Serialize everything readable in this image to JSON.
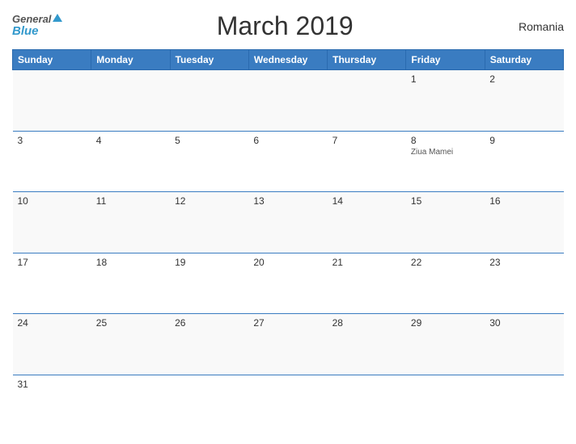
{
  "header": {
    "title": "March 2019",
    "country": "Romania",
    "logo_general": "General",
    "logo_blue": "Blue"
  },
  "days_of_week": [
    "Sunday",
    "Monday",
    "Tuesday",
    "Wednesday",
    "Thursday",
    "Friday",
    "Saturday"
  ],
  "weeks": [
    [
      {
        "num": "",
        "holiday": ""
      },
      {
        "num": "",
        "holiday": ""
      },
      {
        "num": "",
        "holiday": ""
      },
      {
        "num": "",
        "holiday": ""
      },
      {
        "num": "",
        "holiday": ""
      },
      {
        "num": "1",
        "holiday": ""
      },
      {
        "num": "2",
        "holiday": ""
      }
    ],
    [
      {
        "num": "3",
        "holiday": ""
      },
      {
        "num": "4",
        "holiday": ""
      },
      {
        "num": "5",
        "holiday": ""
      },
      {
        "num": "6",
        "holiday": ""
      },
      {
        "num": "7",
        "holiday": ""
      },
      {
        "num": "8",
        "holiday": "Ziua Mamei"
      },
      {
        "num": "9",
        "holiday": ""
      }
    ],
    [
      {
        "num": "10",
        "holiday": ""
      },
      {
        "num": "11",
        "holiday": ""
      },
      {
        "num": "12",
        "holiday": ""
      },
      {
        "num": "13",
        "holiday": ""
      },
      {
        "num": "14",
        "holiday": ""
      },
      {
        "num": "15",
        "holiday": ""
      },
      {
        "num": "16",
        "holiday": ""
      }
    ],
    [
      {
        "num": "17",
        "holiday": ""
      },
      {
        "num": "18",
        "holiday": ""
      },
      {
        "num": "19",
        "holiday": ""
      },
      {
        "num": "20",
        "holiday": ""
      },
      {
        "num": "21",
        "holiday": ""
      },
      {
        "num": "22",
        "holiday": ""
      },
      {
        "num": "23",
        "holiday": ""
      }
    ],
    [
      {
        "num": "24",
        "holiday": ""
      },
      {
        "num": "25",
        "holiday": ""
      },
      {
        "num": "26",
        "holiday": ""
      },
      {
        "num": "27",
        "holiday": ""
      },
      {
        "num": "28",
        "holiday": ""
      },
      {
        "num": "29",
        "holiday": ""
      },
      {
        "num": "30",
        "holiday": ""
      }
    ],
    [
      {
        "num": "31",
        "holiday": ""
      },
      {
        "num": "",
        "holiday": ""
      },
      {
        "num": "",
        "holiday": ""
      },
      {
        "num": "",
        "holiday": ""
      },
      {
        "num": "",
        "holiday": ""
      },
      {
        "num": "",
        "holiday": ""
      },
      {
        "num": "",
        "holiday": ""
      }
    ]
  ]
}
